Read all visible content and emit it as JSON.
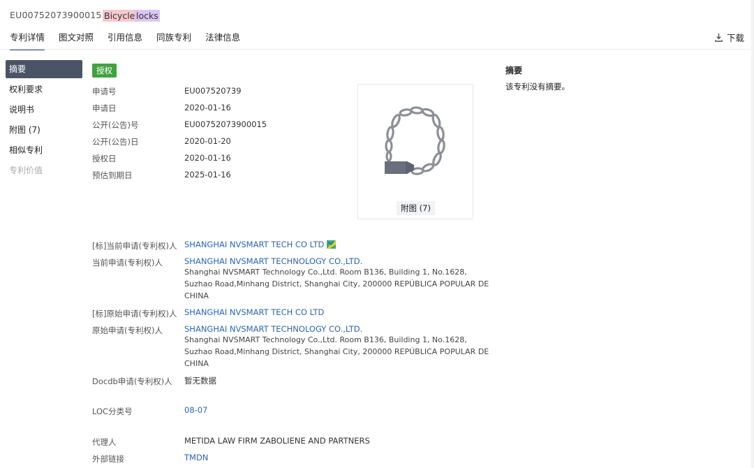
{
  "header": {
    "patent_number": "EU00752073900015",
    "keyword_1": "Bicycle",
    "keyword_2": "locks",
    "download_label": "下载"
  },
  "tabs": [
    {
      "label": "专利详情",
      "active": true
    },
    {
      "label": "图文对照"
    },
    {
      "label": "引用信息"
    },
    {
      "label": "同族专利"
    },
    {
      "label": "法律信息"
    }
  ],
  "sidebar": {
    "items": [
      {
        "label": "摘要",
        "active": true
      },
      {
        "label": "权利要求"
      },
      {
        "label": "说明书"
      },
      {
        "label": "附图 (7)"
      },
      {
        "label": "相似专利"
      },
      {
        "label": "专利价值",
        "disabled": true
      }
    ]
  },
  "status": {
    "badge": "授权",
    "color": "#3fa33f"
  },
  "basic_info": [
    {
      "label": "申请号",
      "value": "EU007520739"
    },
    {
      "label": "申请日",
      "value": "2020-01-16"
    },
    {
      "label": "公开(公告)号",
      "value": "EU00752073900015"
    },
    {
      "label": "公开(公告)日",
      "value": "2020-01-20"
    },
    {
      "label": "授权日",
      "value": "2020-01-16"
    },
    {
      "label": "预估到期日",
      "value": "2025-01-16"
    }
  ],
  "figure": {
    "caption": "附图 (7)"
  },
  "parties": {
    "std_current": {
      "label": "[标]当前申请(专利权)人",
      "value": "SHANGHAI NVSMART TECH CO LTD"
    },
    "current": {
      "label": "当前申请(专利权)人",
      "name": "SHANGHAI NVSMART TECHNOLOGY CO.,LTD.",
      "address_lines": [
        "Shanghai NVSMART Technology Co.,Ltd. Room B136, Building 1, No.1628,",
        "Suzhao Road,Minhang District, Shanghai City, 200000 REPÚBLICA POPULAR DE",
        "CHINA"
      ]
    },
    "std_original": {
      "label": "[标]原始申请(专利权)人",
      "value": "SHANGHAI NVSMART TECH CO LTD"
    },
    "original": {
      "label": "原始申请(专利权)人",
      "name": "SHANGHAI NVSMART TECHNOLOGY CO.,LTD.",
      "address_lines": [
        "Shanghai NVSMART Technology Co.,Ltd. Room B136, Building 1, No.1628,",
        "Suzhao Road,Minhang District, Shanghai City, 200000 REPÚBLICA POPULAR DE",
        "CHINA"
      ]
    },
    "docdb": {
      "label": "Docdb申请(专利权)人",
      "value": "暂无数据"
    }
  },
  "classification": {
    "label": "LOC分类号",
    "value": "08-07"
  },
  "agent": {
    "label": "代理人",
    "value": "METIDA LAW FIRM ZABOLIENE AND PARTNERS"
  },
  "external": {
    "label": "外部链接",
    "value": "TMDN"
  },
  "abstract": {
    "title": "摘要",
    "text": "该专利没有摘要。"
  }
}
